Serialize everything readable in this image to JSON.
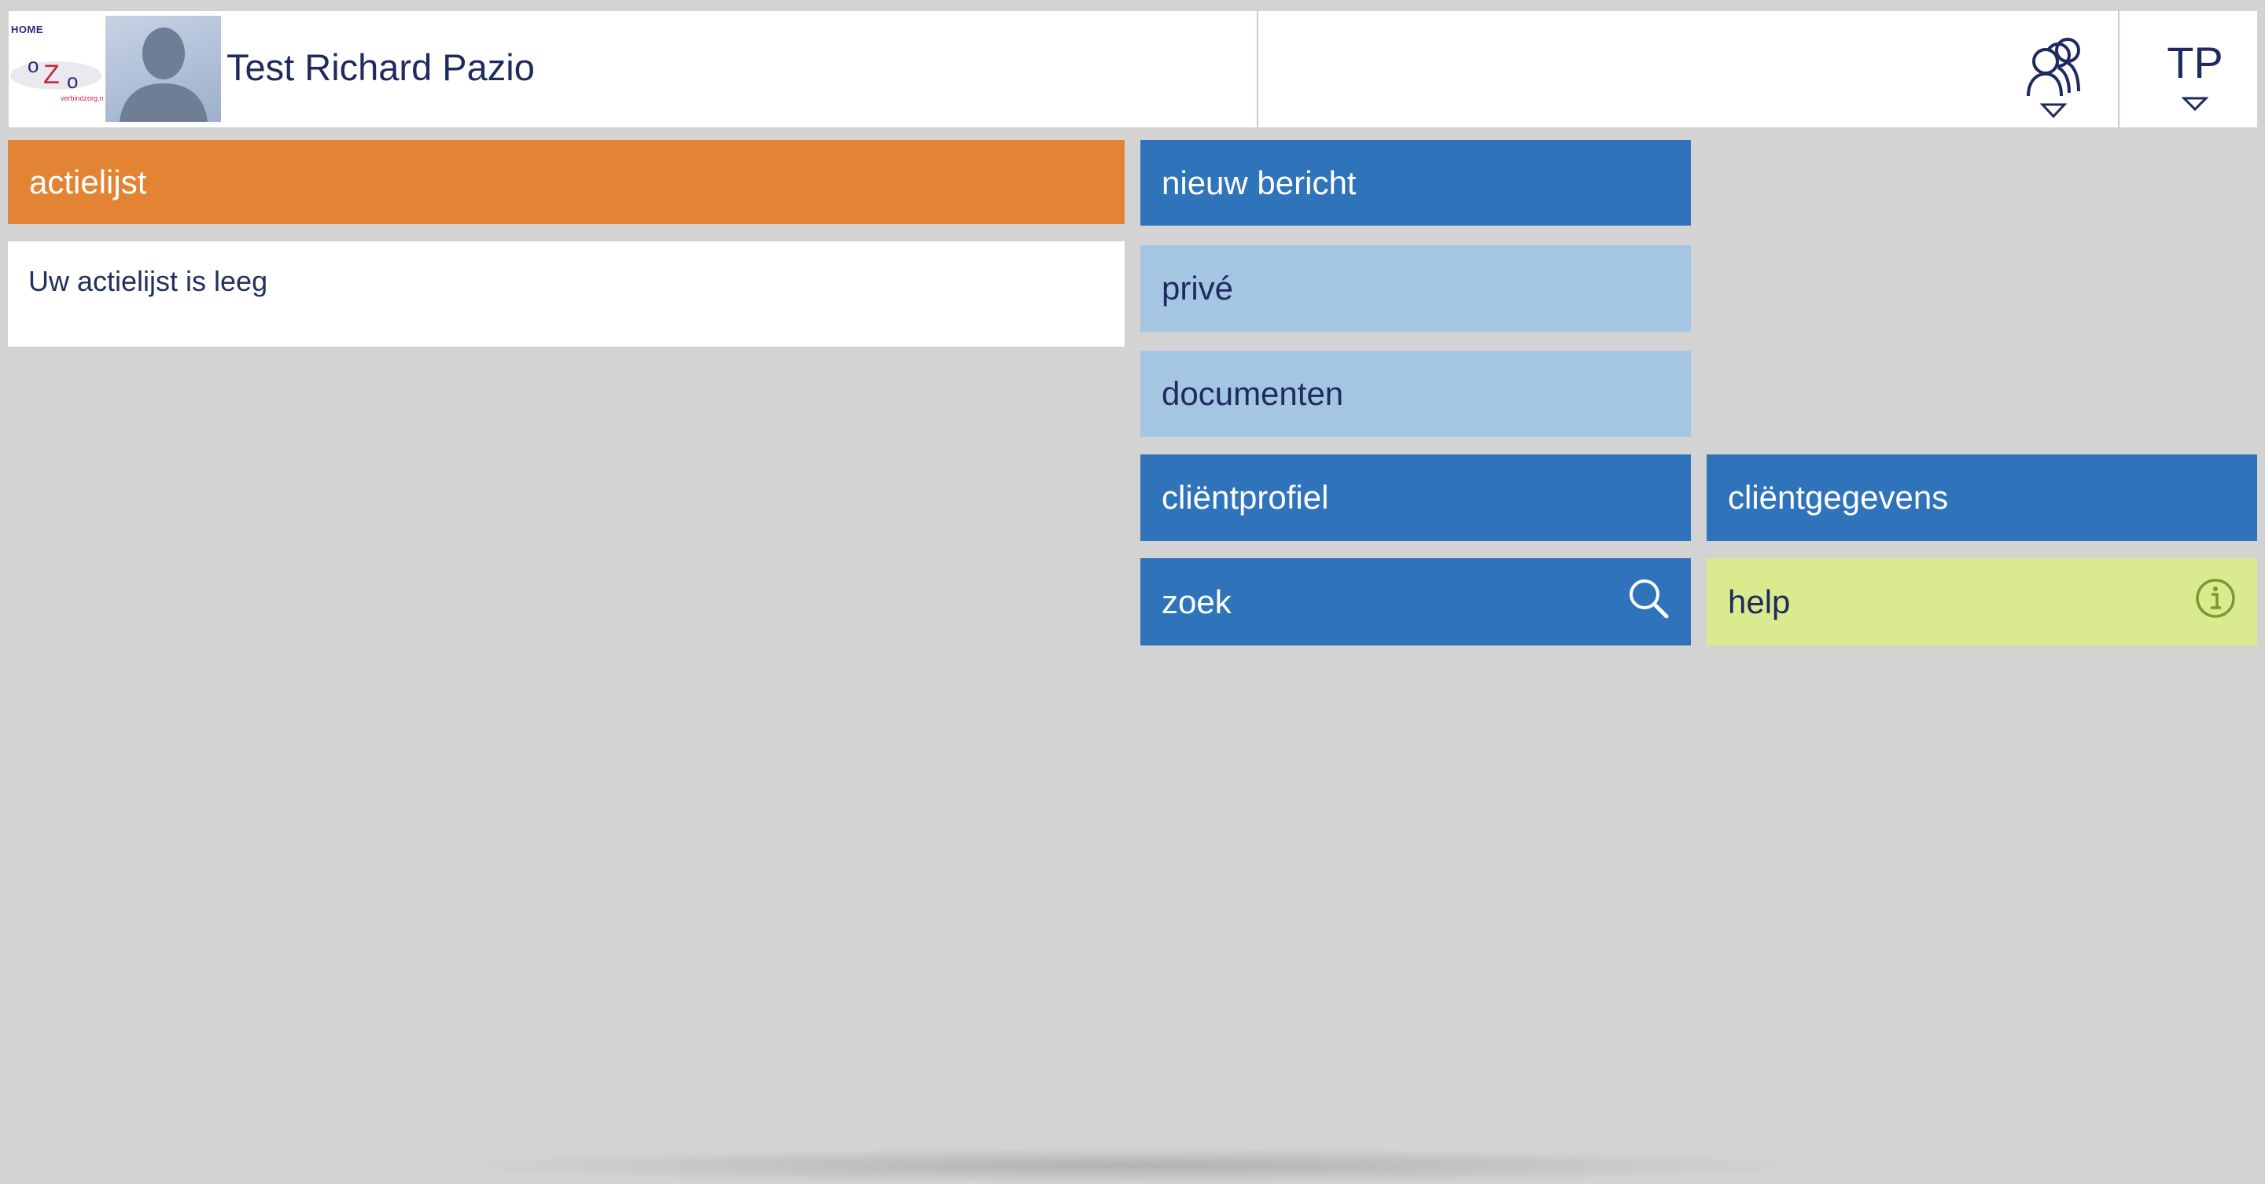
{
  "header": {
    "home_label": "HOME",
    "logo_text": "oZo",
    "logo_sub": "verbindzorg.nl",
    "client_name": "Test Richard Pazio",
    "user_initials": "TP"
  },
  "actions": {
    "title": "actielijst",
    "empty_message": "Uw actielijst is leeg"
  },
  "tiles": {
    "new_message": "nieuw bericht",
    "private": "privé",
    "documents": "documenten",
    "client_profile": "cliëntprofiel",
    "client_data": "cliëntgegevens",
    "search": "zoek",
    "help": "help"
  },
  "colors": {
    "actions_orange": "#e38434",
    "tile_dark_blue": "#2f74ba",
    "tile_light_blue": "#a4c6e2",
    "help_green": "#d9ea8f",
    "background": "#d3d3d3",
    "text_dark": "#1f2a5e"
  },
  "icons": {
    "groups": "people-group-icon",
    "dropdown": "triangle-down-icon",
    "search": "search-icon",
    "info": "info-icon"
  }
}
